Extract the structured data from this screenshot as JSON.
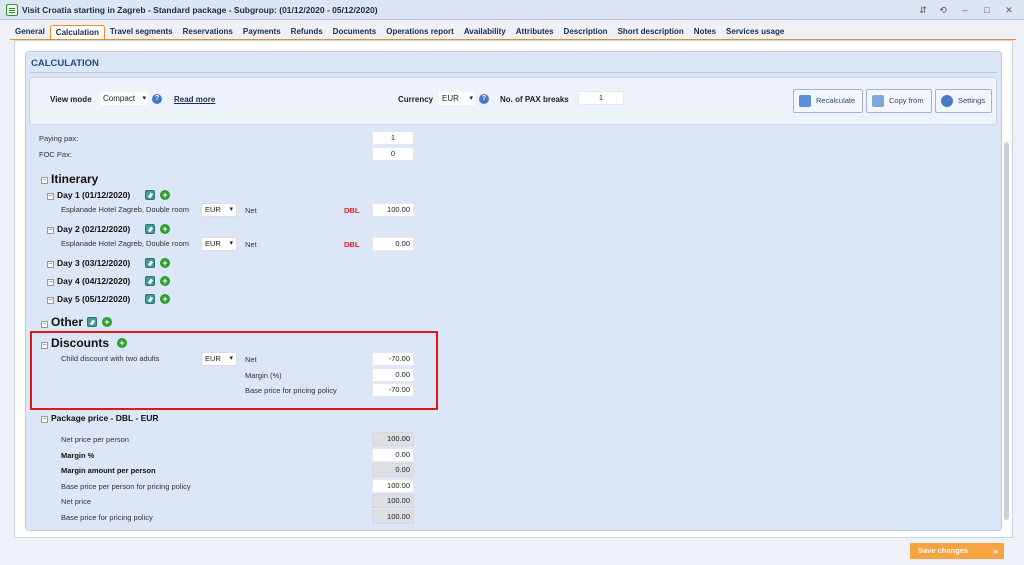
{
  "window": {
    "title": "Visit Croatia starting in Zagreb - Standard package - Subgroup: (01/12/2020 - 05/12/2020)",
    "controls": [
      "⇵",
      "⟲",
      "–",
      "□",
      "✕"
    ]
  },
  "tabs": [
    {
      "label": "General"
    },
    {
      "label": "Calculation",
      "active": true
    },
    {
      "label": "Travel segments"
    },
    {
      "label": "Reservations"
    },
    {
      "label": "Payments"
    },
    {
      "label": "Refunds"
    },
    {
      "label": "Documents"
    },
    {
      "label": "Operations report"
    },
    {
      "label": "Availability"
    },
    {
      "label": "Attributes"
    },
    {
      "label": "Description"
    },
    {
      "label": "Short description"
    },
    {
      "label": "Notes"
    },
    {
      "label": "Services usage"
    }
  ],
  "section": {
    "title": "CALCULATION"
  },
  "toolbar": {
    "view_mode_label": "View mode",
    "view_mode_value": "Compact",
    "read_more": "Read more",
    "currency_label": "Currency",
    "currency_value": "EUR",
    "pax_breaks_label": "No. of PAX breaks",
    "pax_breaks_value": "1",
    "recalculate": "Recalculate",
    "copy_from": "Copy from",
    "settings": "Settings",
    "help_glyph": "?"
  },
  "pax": {
    "paying_label": "Paying pax:",
    "paying_value": "1",
    "foc_label": "FOC Pax:",
    "foc_value": "0"
  },
  "itinerary": {
    "title": "Itinerary",
    "days": [
      {
        "label": "Day 1 (01/12/2020)",
        "service": "Esplanade Hotel Zagreb, Double room",
        "currency": "EUR",
        "type": "Net",
        "room": "DBL",
        "value": "100.00"
      },
      {
        "label": "Day 2 (02/12/2020)",
        "service": "Esplanade Hotel Zagreb, Double room",
        "currency": "EUR",
        "type": "Net",
        "room": "DBL",
        "value": "0.00"
      },
      {
        "label": "Day 3 (03/12/2020)"
      },
      {
        "label": "Day 4 (04/12/2020)"
      },
      {
        "label": "Day 5 (05/12/2020)"
      }
    ]
  },
  "other": {
    "title": "Other"
  },
  "discounts": {
    "title": "Discounts",
    "item": "Child discount with two adults",
    "currency": "EUR",
    "net_label": "Net",
    "net_value": "-70.00",
    "margin_label": "Margin (%)",
    "margin_value": "0.00",
    "base_label": "Base price for pricing policy",
    "base_value": "-70.00"
  },
  "package_price": {
    "title": "Package price - DBL - EUR",
    "rows": [
      {
        "label": "Net price per person",
        "value": "100.00",
        "bold": false,
        "readonly": true
      },
      {
        "label": "Margin %",
        "value": "0.00",
        "bold": true,
        "readonly": false
      },
      {
        "label": "Margin amount per person",
        "value": "0.00",
        "bold": true,
        "readonly": true
      },
      {
        "label": "Base price per person for pricing policy",
        "value": "100.00",
        "bold": false,
        "readonly": false
      },
      {
        "label": "Net price",
        "value": "100.00",
        "bold": false,
        "readonly": true
      },
      {
        "label": "Base price for pricing policy",
        "value": "100.00",
        "bold": false,
        "readonly": true
      }
    ]
  },
  "footer": {
    "save_label": "Save changes",
    "save_arrow": "»"
  },
  "glyphs": {
    "minus": "−",
    "plus": "+",
    "dropdown": "▾"
  },
  "colors": {
    "accent": "#f08a24",
    "save": "#f6a340",
    "highlight": "#e01818",
    "room": "#e02020"
  }
}
